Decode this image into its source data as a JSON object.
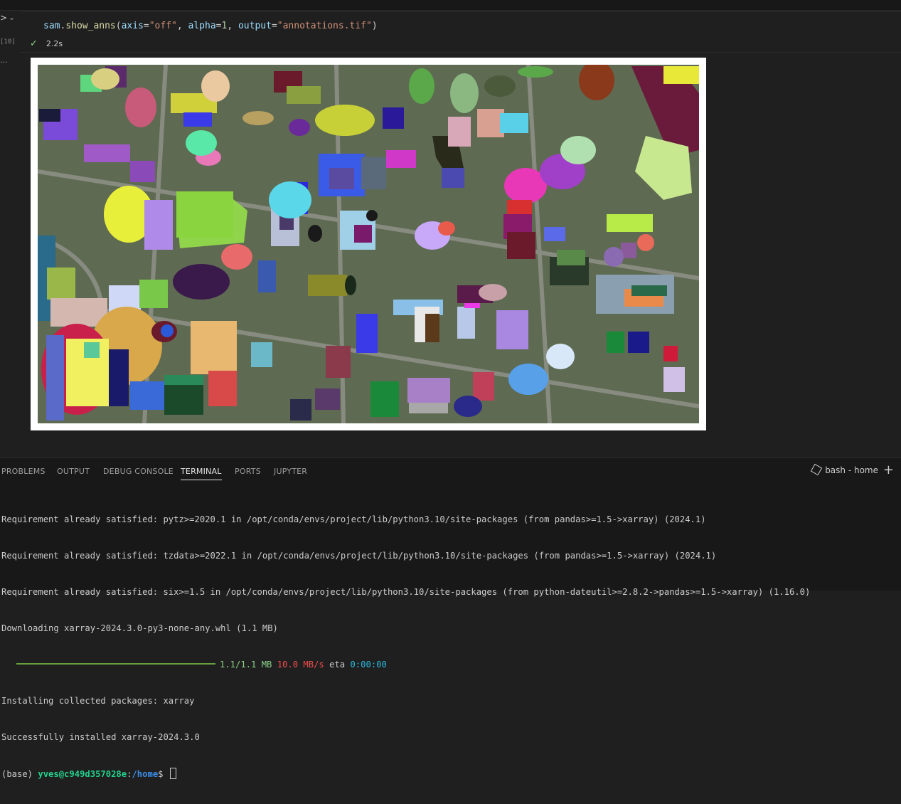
{
  "notebook": {
    "execution_count": "[10]",
    "output_ellipsis": "...",
    "code": {
      "object": "sam",
      "dot": ".",
      "method": "show_anns",
      "open": "(",
      "arg1_name": "axis",
      "eq": "=",
      "arg1_value": "\"off\"",
      "comma": ", ",
      "arg2_name": "alpha",
      "arg2_value": "1",
      "arg3_name": "output",
      "arg3_value": "\"annotations.tif\"",
      "close": ")"
    },
    "run_status": {
      "icon": "check-icon",
      "duration": "2.2s"
    },
    "output_image": {
      "description_icon": "segmentation-map-image"
    }
  },
  "panel": {
    "tabs": [
      "PROBLEMS",
      "OUTPUT",
      "DEBUG CONSOLE",
      "TERMINAL",
      "PORTS",
      "JUPYTER"
    ],
    "active_tab": "TERMINAL",
    "terminal_name": "bash - home",
    "terminal_icon": "terminal-icon",
    "add_icon": "plus-icon"
  },
  "terminal": {
    "lines": [
      "Requirement already satisfied: pytz>=2020.1 in /opt/conda/envs/project/lib/python3.10/site-packages (from pandas>=1.5->xarray) (2024.1)",
      "Requirement already satisfied: tzdata>=2022.1 in /opt/conda/envs/project/lib/python3.10/site-packages (from pandas>=1.5->xarray) (2024.1)",
      "Requirement already satisfied: six>=1.5 in /opt/conda/envs/project/lib/python3.10/site-packages (from python-dateutil>=2.8.2->pandas>=1.5->xarray) (1.16.0)",
      "Downloading xarray-2024.3.0-py3-none-any.whl (1.1 MB)"
    ],
    "progress": {
      "fraction": 1.0,
      "size": "1.1/1.1 MB",
      "speed": "10.0 MB/s",
      "eta_label": "eta",
      "eta": "0:00:00"
    },
    "after": [
      "Installing collected packages: xarray",
      "Successfully installed xarray-2024.3.0"
    ],
    "prompt": {
      "env": "(base) ",
      "user": "yves@c949d357028e",
      "colon": ":",
      "path": "/home",
      "symbol": "$ "
    },
    "colors": {
      "progress_bar": "#6a9f3d",
      "size": "#89d185",
      "speed": "#f14c4c",
      "eta": "#29b8db",
      "user": "#23d18b",
      "path": "#3b8eea"
    }
  }
}
